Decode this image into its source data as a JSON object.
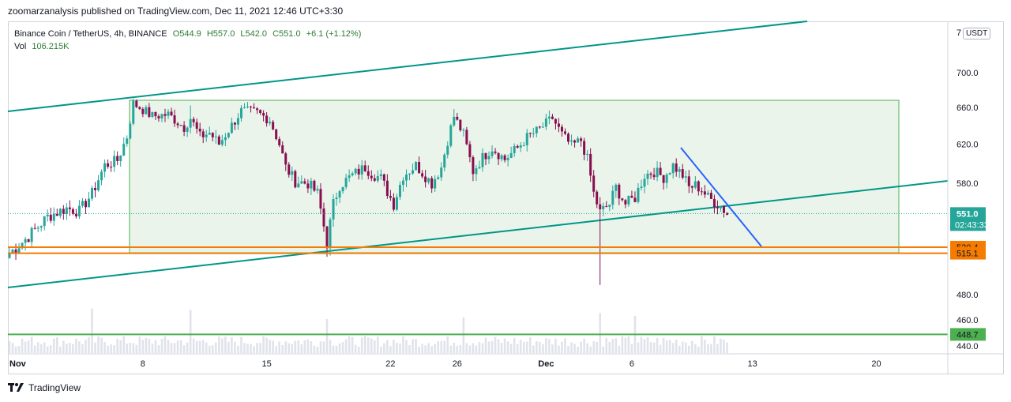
{
  "publisher": "zoomarzanalysis published on TradingView.com, Dec 11, 2021 12:46 UTC+3:30",
  "legend": {
    "symbol": "Binance Coin / TetherUS, 4h, BINANCE",
    "open": "O544.9",
    "high": "H557.0",
    "low": "L542.0",
    "close": "C551.0",
    "change": "+6.1 (+1.12%)",
    "vol_label": "Vol",
    "vol_value": "106.215K"
  },
  "currency": "USDT",
  "price_axis": {
    "ticks": [
      "700.0",
      "660.0",
      "620.0",
      "580.0",
      "480.0",
      "460.0",
      "440.0"
    ],
    "top_partial": "7",
    "last_price": "551.0",
    "countdown": "02:43:33",
    "levels": [
      {
        "label": "520.4",
        "color": "#f57c00"
      },
      {
        "label": "515.1",
        "color": "#f57c00"
      },
      {
        "label": "448.7",
        "color": "#4caf50"
      }
    ]
  },
  "time_axis": [
    "Nov",
    "8",
    "15",
    "22",
    "26",
    "Dec",
    "6",
    "13",
    "20"
  ],
  "footer": {
    "brand": "TradingView"
  },
  "colors": {
    "up": "#26a69a",
    "down": "#880e4f",
    "channel": "#009688",
    "range_fill": "#e6f2e6",
    "range_border": "#4caf50",
    "trend": "#2962ff",
    "level_orange": "#f57c00",
    "level_green": "#4caf50",
    "vol": "#e0e3eb"
  },
  "chart_data": {
    "type": "candlestick",
    "interval": "4h",
    "price_scale": "log",
    "levels": [
      520.4,
      515.1,
      448.7
    ],
    "close_path": [
      [
        0,
        515
      ],
      [
        6,
        530
      ],
      [
        12,
        548
      ],
      [
        18,
        556
      ],
      [
        22,
        553
      ],
      [
        26,
        570
      ],
      [
        30,
        598
      ],
      [
        34,
        603
      ],
      [
        37,
        628
      ],
      [
        39,
        664
      ],
      [
        41,
        660
      ],
      [
        45,
        650
      ],
      [
        50,
        652
      ],
      [
        55,
        638
      ],
      [
        57,
        648
      ],
      [
        60,
        628
      ],
      [
        63,
        632
      ],
      [
        66,
        620
      ],
      [
        70,
        640
      ],
      [
        73,
        656
      ],
      [
        78,
        654
      ],
      [
        82,
        646
      ],
      [
        85,
        620
      ],
      [
        87,
        596
      ],
      [
        90,
        582
      ],
      [
        94,
        580
      ],
      [
        97,
        570
      ],
      [
        100,
        524
      ],
      [
        102,
        560
      ],
      [
        104,
        578
      ],
      [
        108,
        588
      ],
      [
        112,
        596
      ],
      [
        114,
        590
      ],
      [
        117,
        585
      ],
      [
        119,
        572
      ],
      [
        121,
        560
      ],
      [
        124,
        588
      ],
      [
        128,
        598
      ],
      [
        133,
        580
      ],
      [
        136,
        596
      ],
      [
        138,
        624
      ],
      [
        140,
        650
      ],
      [
        143,
        630
      ],
      [
        146,
        592
      ],
      [
        149,
        606
      ],
      [
        152,
        616
      ],
      [
        156,
        604
      ],
      [
        160,
        616
      ],
      [
        163,
        627
      ],
      [
        167,
        636
      ],
      [
        171,
        648
      ],
      [
        174,
        630
      ],
      [
        177,
        618
      ],
      [
        180,
        624
      ],
      [
        182,
        604
      ],
      [
        184,
        570
      ],
      [
        186,
        552
      ],
      [
        189,
        560
      ],
      [
        191,
        576
      ],
      [
        194,
        560
      ],
      [
        197,
        566
      ],
      [
        200,
        588
      ],
      [
        203,
        592
      ],
      [
        206,
        586
      ],
      [
        209,
        598
      ],
      [
        212,
        588
      ],
      [
        214,
        576
      ],
      [
        216,
        578
      ],
      [
        218,
        574
      ],
      [
        220,
        566
      ],
      [
        222,
        562
      ],
      [
        224,
        558
      ],
      [
        226,
        551
      ]
    ]
  }
}
